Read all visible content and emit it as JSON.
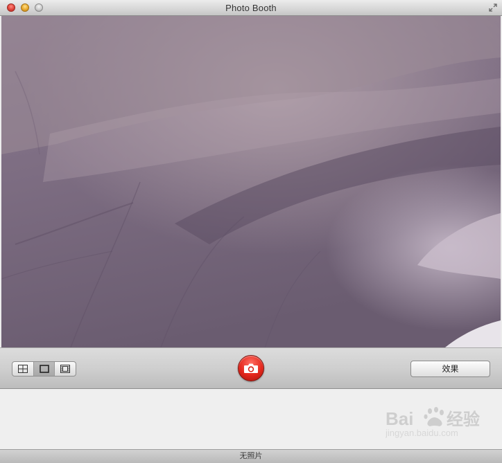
{
  "window": {
    "title": "Photo Booth"
  },
  "toolbar": {
    "layout_modes": [
      {
        "name": "four-up",
        "icon": "four-grid-icon",
        "selected": false
      },
      {
        "name": "single",
        "icon": "single-frame-icon",
        "selected": true
      },
      {
        "name": "movie",
        "icon": "film-strip-icon",
        "selected": false
      }
    ],
    "shutter_icon": "camera-icon",
    "effects_label": "效果"
  },
  "status": {
    "text": "无照片"
  },
  "watermark": {
    "brand": "Baidu经验",
    "url": "jingyan.baidu.com"
  },
  "colors": {
    "shutter": "#e4271c",
    "camera_tint": "#7a6a7e"
  }
}
